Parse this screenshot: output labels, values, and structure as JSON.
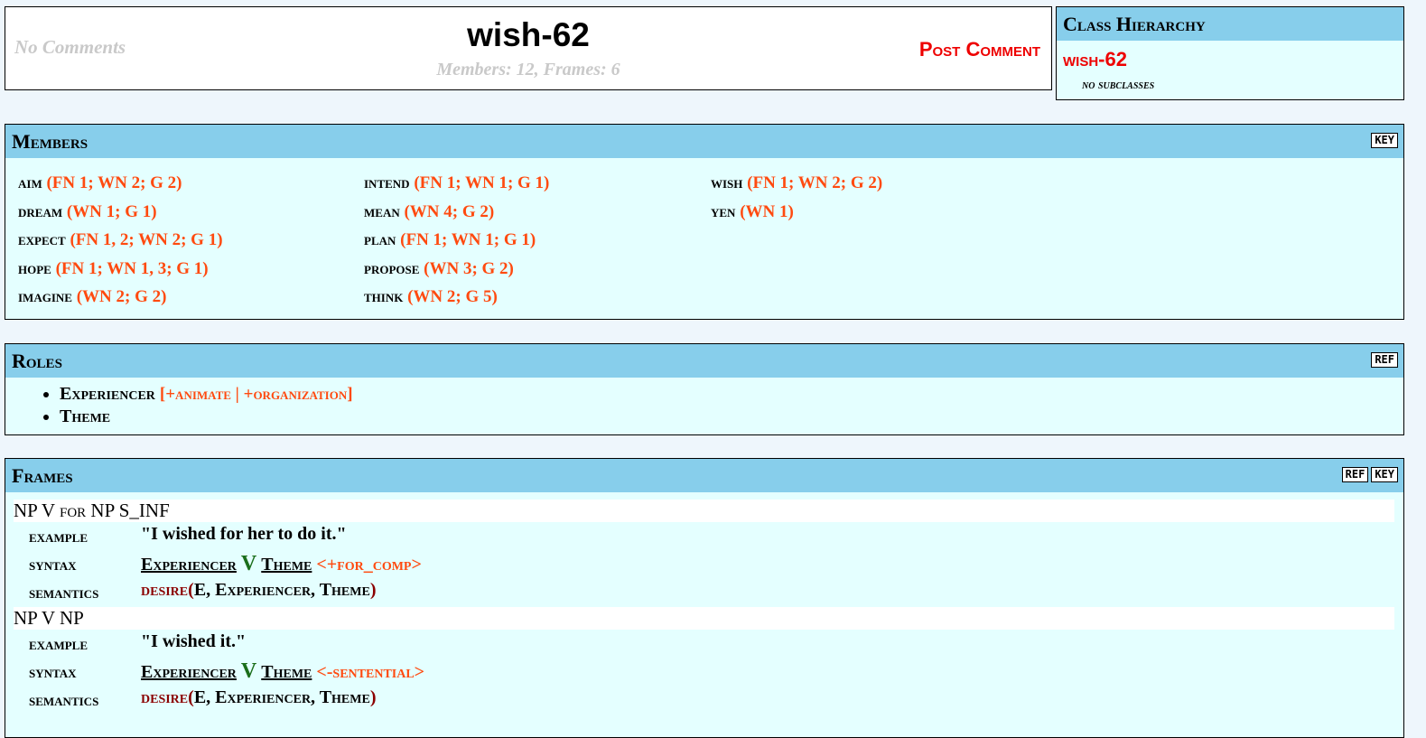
{
  "header": {
    "no_comments": "No Comments",
    "title": "wish-62",
    "stats": "Members: 12, Frames: 6",
    "post_comment": "Post Comment"
  },
  "hierarchy": {
    "heading": "Class Hierarchy",
    "current": "wish-62",
    "subclasses": "no subclasses"
  },
  "members": {
    "heading": "Members",
    "badge": "KEY",
    "columns": [
      [
        {
          "name": "aim",
          "refs": "(FN 1; WN 2; G 2)"
        },
        {
          "name": "dream",
          "refs": "(WN 1; G 1)"
        },
        {
          "name": "expect",
          "refs": "(FN 1, 2; WN 2; G 1)"
        },
        {
          "name": "hope",
          "refs": "(FN 1; WN 1, 3; G 1)"
        },
        {
          "name": "imagine",
          "refs": "(WN 2; G 2)"
        }
      ],
      [
        {
          "name": "intend",
          "refs": "(FN 1; WN 1; G 1)"
        },
        {
          "name": "mean",
          "refs": "(WN 4; G 2)"
        },
        {
          "name": "plan",
          "refs": "(FN 1; WN 1; G 1)"
        },
        {
          "name": "propose",
          "refs": "(WN 3; G 2)"
        },
        {
          "name": "think",
          "refs": "(WN 2; G 5)"
        }
      ],
      [
        {
          "name": "wish",
          "refs": "(FN 1; WN 2; G 2)"
        },
        {
          "name": "yen",
          "refs": "(WN 1)"
        }
      ]
    ]
  },
  "roles": {
    "heading": "Roles",
    "badge": "REF",
    "items": [
      {
        "name": "Experiencer",
        "restriction": "[+animate | +organization]"
      },
      {
        "name": "Theme",
        "restriction": ""
      }
    ]
  },
  "frames": {
    "heading": "Frames",
    "badges": [
      "REF",
      "KEY"
    ],
    "labels": {
      "example": "example",
      "syntax": "syntax",
      "semantics": "semantics"
    },
    "items": [
      {
        "title_a": "NP V ",
        "title_b": "for",
        "title_c": " NP S_INF",
        "example": "\"I wished for her to do it.\"",
        "syntax": {
          "arg1": "Experiencer",
          "verb": "V",
          "arg2": "Theme",
          "restriction": "<+for_comp>"
        },
        "semantics": {
          "pred": "desire",
          "open": "(",
          "args": "E, Experiencer, Theme",
          "close": ")"
        }
      },
      {
        "title_a": "NP V NP",
        "title_b": "",
        "title_c": "",
        "example": "\"I wished it.\"",
        "syntax": {
          "arg1": "Experiencer",
          "verb": "V",
          "arg2": "Theme",
          "restriction": "<-sentential>"
        },
        "semantics": {
          "pred": "desire",
          "open": "(",
          "args": "E, Experiencer, Theme",
          "close": ")"
        }
      }
    ]
  }
}
